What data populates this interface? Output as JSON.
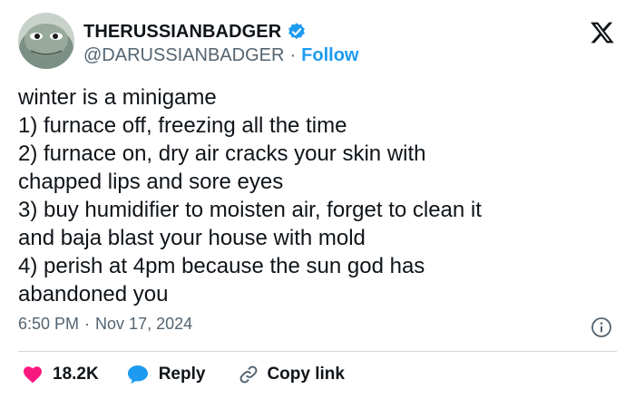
{
  "author": {
    "display_name": "THERUSSIANBADGER",
    "handle": "@DARUSSIANBADGER",
    "separator": "·",
    "follow_label": "Follow",
    "verified": true
  },
  "tweet": {
    "lines": [
      "winter is a minigame",
      "1) furnace off, freezing all the time",
      "2) furnace on, dry air cracks your skin with",
      "chapped lips and sore eyes",
      "3) buy humidifier to moisten air, forget to clean it",
      "and baja blast your house with mold",
      "4) perish at 4pm because the sun god has",
      "abandoned you"
    ],
    "time": "6:50 PM",
    "separator": "·",
    "date": "Nov 17, 2024"
  },
  "actions": {
    "like_count": "18.2K",
    "reply_label": "Reply",
    "copy_label": "Copy link"
  },
  "colors": {
    "accent": "#1d9bf0",
    "like": "#f91880",
    "text": "#0f1419",
    "muted": "#536471",
    "divider": "#cfd9de"
  },
  "icons": [
    "avatar",
    "verified-badge-icon",
    "x-logo-icon",
    "info-icon",
    "heart-icon",
    "reply-bubble-icon",
    "link-icon"
  ]
}
